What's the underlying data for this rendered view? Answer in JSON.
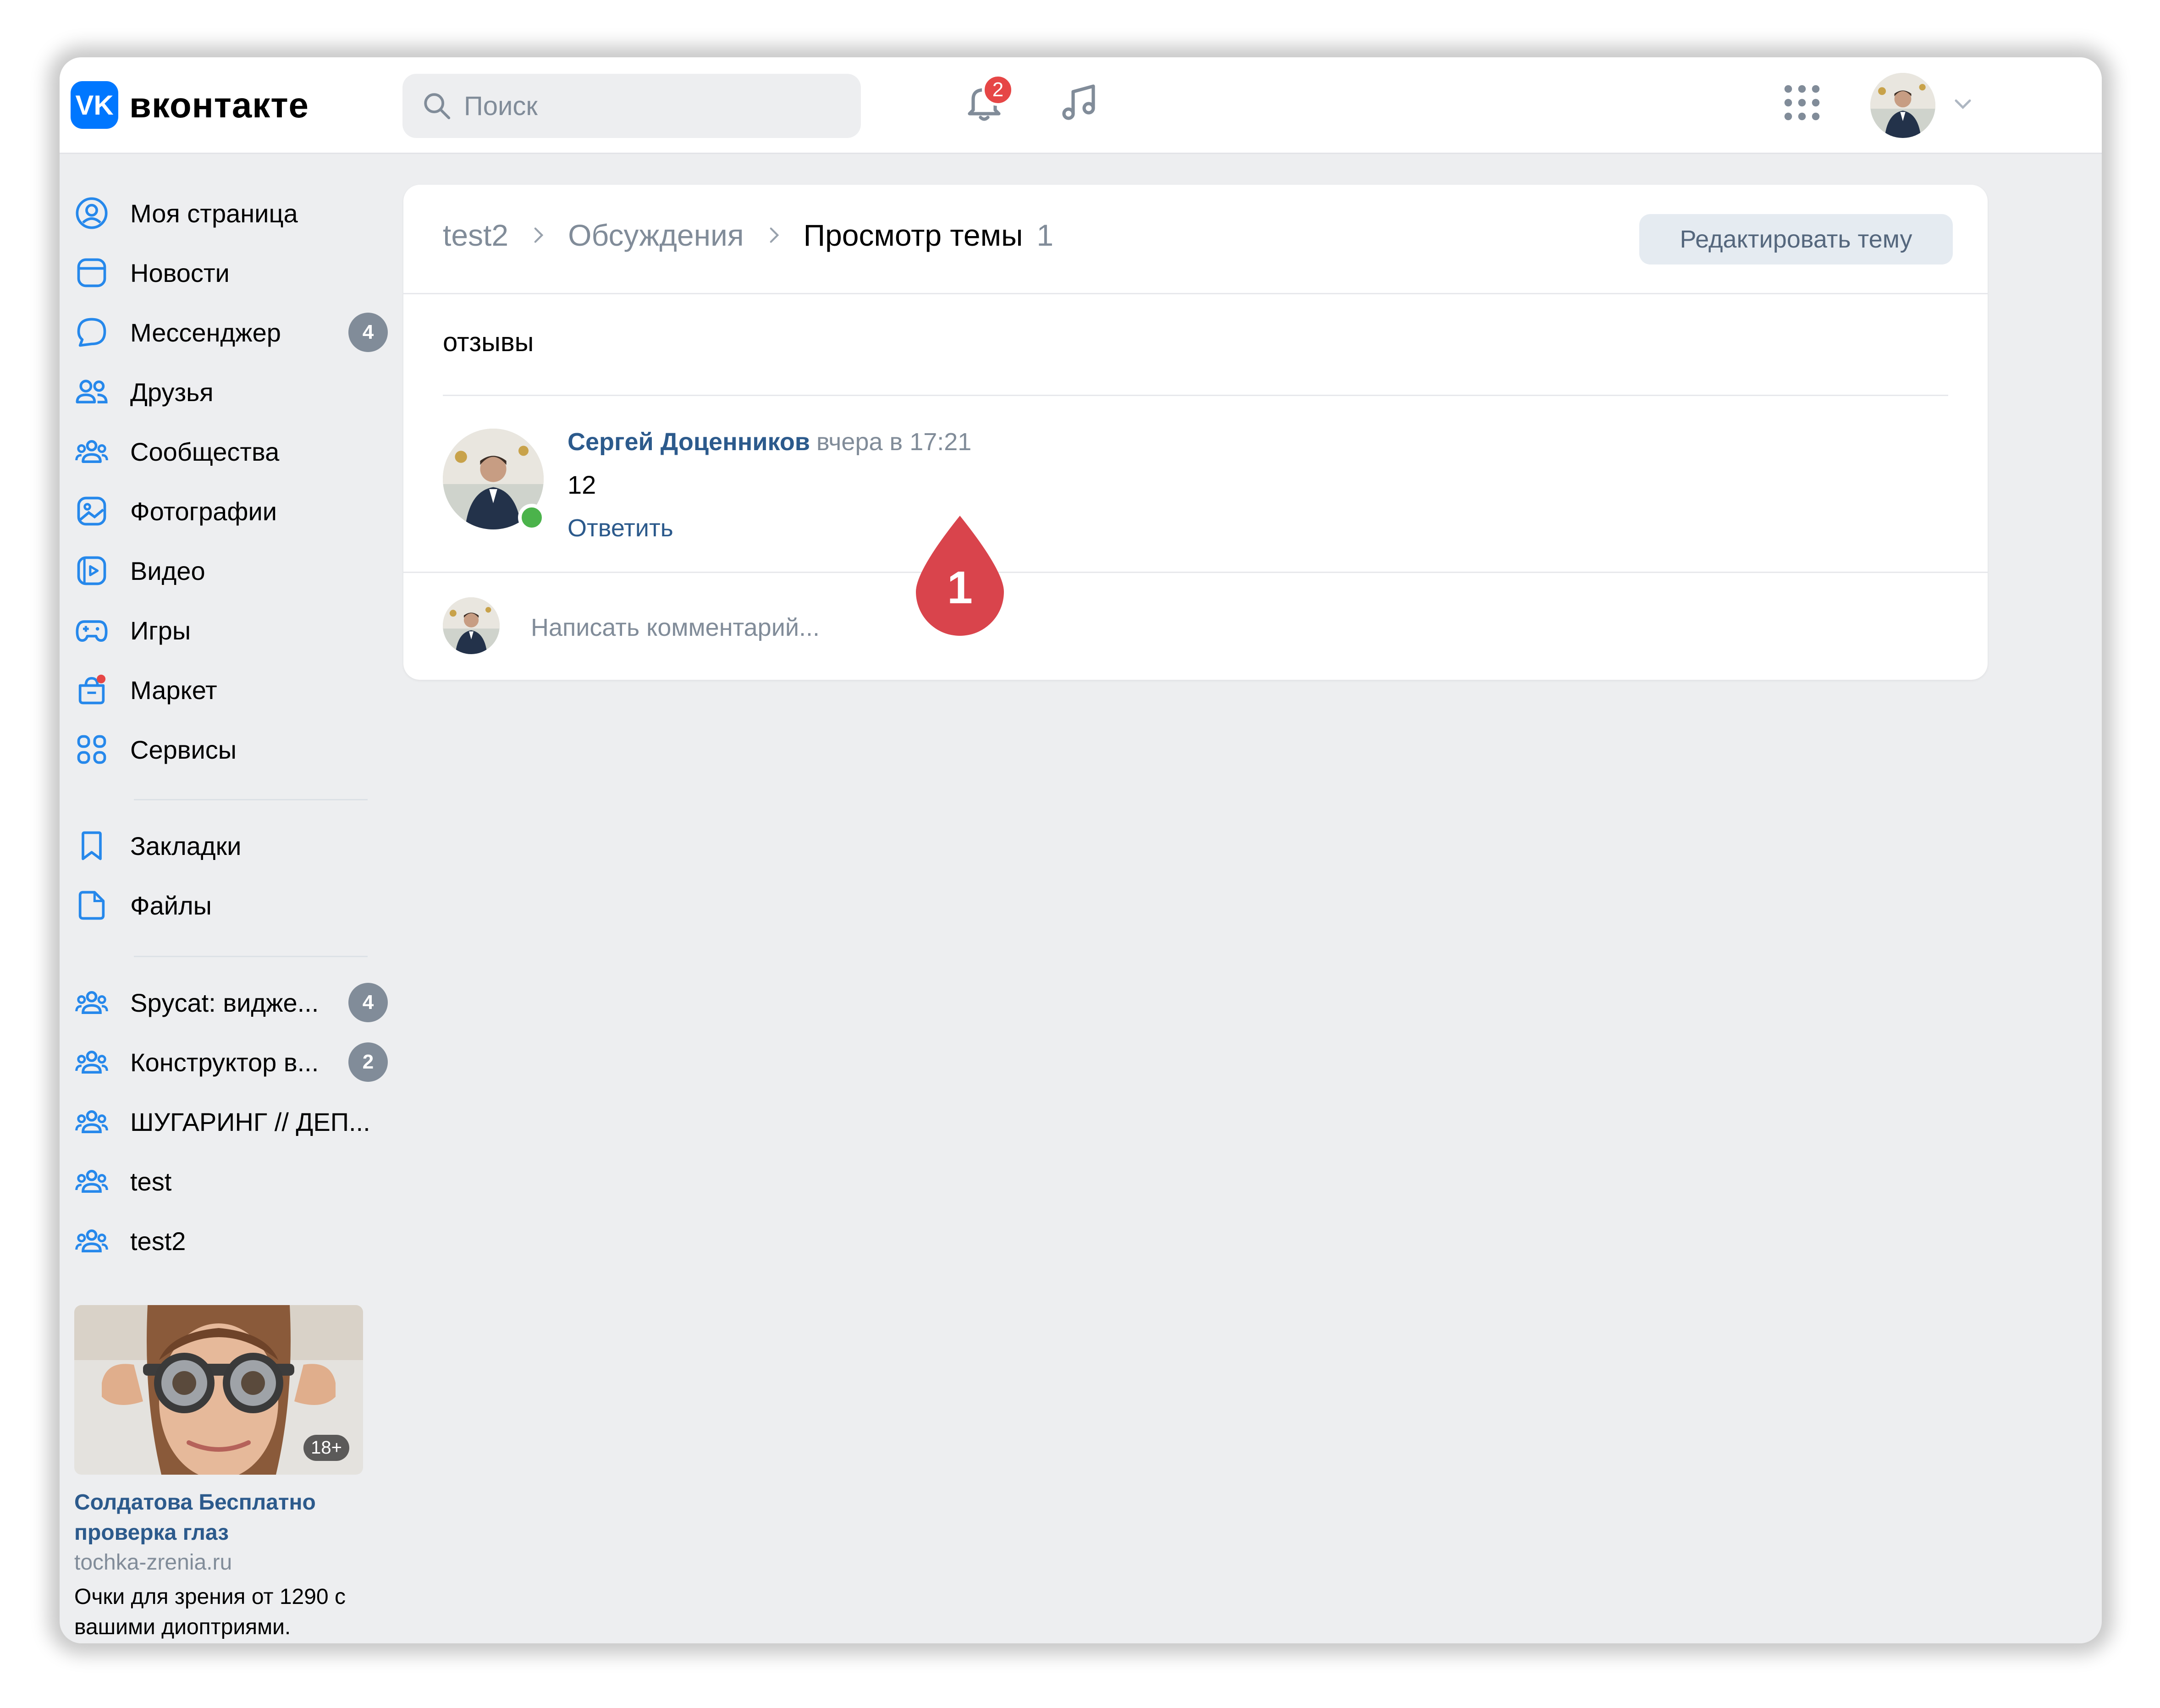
{
  "brand": {
    "logo_mark": "VK",
    "name": "вконтакте"
  },
  "search": {
    "placeholder": "Поиск"
  },
  "header": {
    "notifications_badge": "2",
    "icons": [
      "search-icon",
      "bell-icon",
      "music-icon",
      "apps-grid-icon",
      "chevron-down-icon"
    ]
  },
  "sidebar": {
    "items": [
      {
        "label": "Моя страница",
        "icon": "user-circle-icon"
      },
      {
        "label": "Новости",
        "icon": "newsfeed-icon"
      },
      {
        "label": "Мессенджер",
        "icon": "message-icon",
        "count": "4"
      },
      {
        "label": "Друзья",
        "icon": "friends-icon"
      },
      {
        "label": "Сообщества",
        "icon": "communities-icon"
      },
      {
        "label": "Фотографии",
        "icon": "photo-icon"
      },
      {
        "label": "Видео",
        "icon": "video-icon"
      },
      {
        "label": "Игры",
        "icon": "gamepad-icon"
      },
      {
        "label": "Маркет",
        "icon": "market-icon"
      },
      {
        "label": "Сервисы",
        "icon": "services-icon"
      },
      {
        "label": "Закладки",
        "icon": "bookmark-icon"
      },
      {
        "label": "Файлы",
        "icon": "file-icon"
      },
      {
        "label": "Spycat: видже...",
        "icon": "group-icon",
        "count": "4"
      },
      {
        "label": "Конструктор в...",
        "icon": "group-icon",
        "count": "2"
      },
      {
        "label": "ШУГАРИНГ // ДЕП...",
        "icon": "group-icon"
      },
      {
        "label": "test",
        "icon": "group-icon"
      },
      {
        "label": "test2",
        "icon": "group-icon"
      }
    ]
  },
  "ad": {
    "age": "18+",
    "title": "Солдатова Бесплатно проверка глаз",
    "domain": "tochka-zrenia.ru",
    "text": "Очки для зрения от 1290 с вашими диоптриями."
  },
  "topic": {
    "breadcrumb": [
      "test2",
      "Обсуждения",
      "Просмотр темы"
    ],
    "count": "1",
    "edit_button": "Редактировать тему",
    "title": "отзывы",
    "post": {
      "author": "Сергей Доценников",
      "time": "вчера в 17:21",
      "text": "12",
      "reply": "Ответить"
    },
    "comment_placeholder": "Написать комментарий..."
  },
  "callout": {
    "number": "1",
    "color": "#d9444c"
  },
  "colors": {
    "accent": "#0077ff",
    "link": "#2c5a8c",
    "badge_red": "#e64646",
    "online": "#4bb34b"
  }
}
